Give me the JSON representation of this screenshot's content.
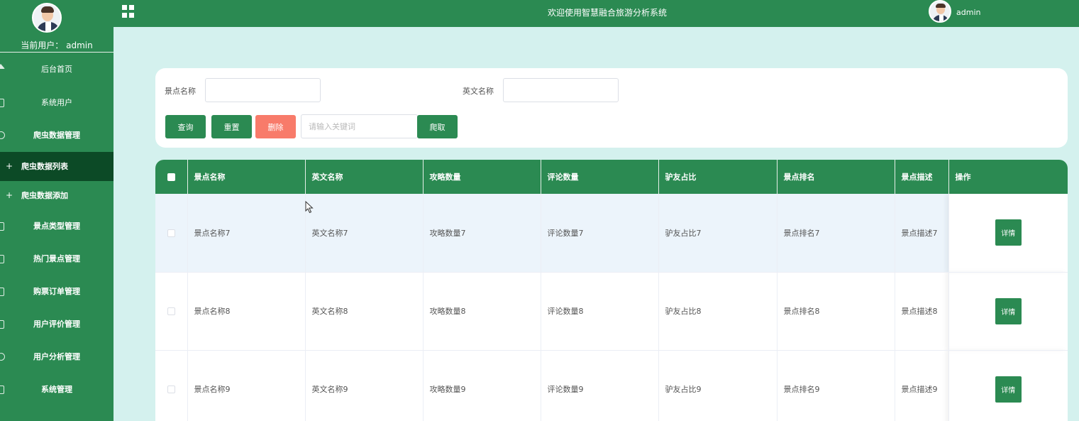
{
  "sidebar": {
    "current_user_label": "当前用户： admin",
    "items": [
      {
        "label": "后台首页",
        "icon": "home-icon"
      },
      {
        "label": "系统用户",
        "icon": "user-icon"
      },
      {
        "label": "爬虫数据管理",
        "icon": "data-icon"
      },
      {
        "label": "爬虫数据列表",
        "icon": "plus-icon",
        "active": true
      },
      {
        "label": "爬虫数据添加",
        "icon": "plus-icon"
      },
      {
        "label": "景点类型管理",
        "icon": "doc-icon"
      },
      {
        "label": "热门景点管理",
        "icon": "shield-icon"
      },
      {
        "label": "购票订单管理",
        "icon": "doc-icon"
      },
      {
        "label": "用户评价管理",
        "icon": "doc-icon"
      },
      {
        "label": "用户分析管理",
        "icon": "chart-icon"
      },
      {
        "label": "系统管理",
        "icon": "gear-icon"
      }
    ]
  },
  "header": {
    "title": "欢迎使用智慧融合旅游分析系统",
    "username": "admin"
  },
  "search": {
    "name_label": "景点名称",
    "name_value": "",
    "en_label": "英文名称",
    "en_value": "",
    "query_btn": "查询",
    "reset_btn": "重置",
    "delete_btn": "删除",
    "keyword_placeholder": "请输入关键词",
    "crawl_btn": "爬取"
  },
  "table": {
    "columns": [
      "景点名称",
      "英文名称",
      "攻略数量",
      "评论数量",
      "驴友占比",
      "景点排名",
      "景点描述",
      "操作"
    ],
    "rows": [
      [
        "景点名称7",
        "英文名称7",
        "攻略数量7",
        "评论数量7",
        "驴友占比7",
        "景点排名7",
        "景点描述7"
      ],
      [
        "景点名称8",
        "英文名称8",
        "攻略数量8",
        "评论数量8",
        "驴友占比8",
        "景点排名8",
        "景点描述8"
      ],
      [
        "景点名称9",
        "英文名称9",
        "攻略数量9",
        "评论数量9",
        "驴友占比9",
        "景点排名9",
        "景点描述9"
      ]
    ],
    "detail_btn": "详情"
  },
  "colors": {
    "primary": "#2b8a52",
    "active_menu": "#0c4a26",
    "danger": "#f87b6a",
    "background": "#d4f1ee"
  }
}
